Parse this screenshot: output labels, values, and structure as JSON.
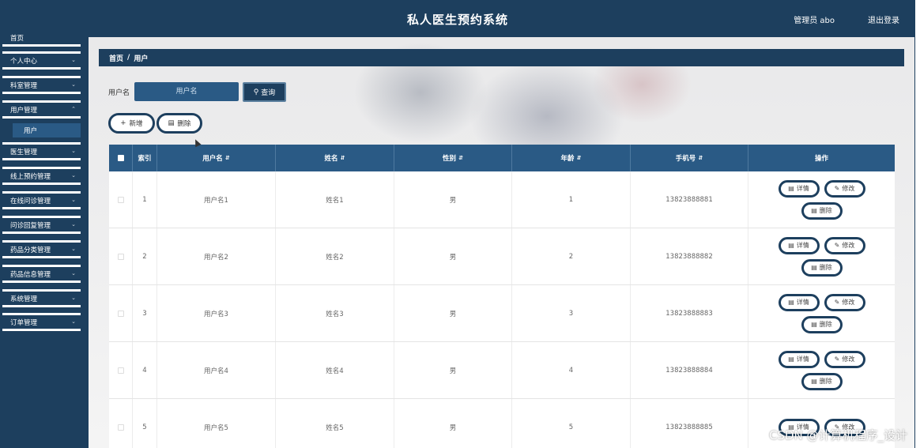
{
  "header": {
    "title": "私人医生预约系统",
    "user": "管理员 abo",
    "logout": "退出登录"
  },
  "sidebar": {
    "top_cut": "首页",
    "items": [
      {
        "label": "个人中心"
      },
      {
        "label": "科室管理"
      },
      {
        "label": "用户管理",
        "sub": "用户"
      },
      {
        "label": "医生管理"
      },
      {
        "label": "线上预约管理"
      },
      {
        "label": "在线问诊管理"
      },
      {
        "label": "问诊回复管理"
      },
      {
        "label": "药品分类管理"
      },
      {
        "label": "药品信息管理"
      },
      {
        "label": "系统管理"
      },
      {
        "label": "订单管理"
      }
    ]
  },
  "breadcrumb": {
    "home": "首页",
    "sep": "/",
    "current": "用户"
  },
  "search": {
    "label": "用户名",
    "placeholder": "用户名",
    "button": "查询"
  },
  "actions": {
    "add": "新增",
    "delete": "删除"
  },
  "table": {
    "headers": [
      "索引",
      "用户名",
      "姓名",
      "性别",
      "年龄",
      "手机号",
      "操作"
    ],
    "rows": [
      {
        "index": "1",
        "username": "用户名1",
        "name": "姓名1",
        "gender": "男",
        "age": "1",
        "phone": "13823888881"
      },
      {
        "index": "2",
        "username": "用户名2",
        "name": "姓名2",
        "gender": "男",
        "age": "2",
        "phone": "13823888882"
      },
      {
        "index": "3",
        "username": "用户名3",
        "name": "姓名3",
        "gender": "男",
        "age": "3",
        "phone": "13823888883"
      },
      {
        "index": "4",
        "username": "用户名4",
        "name": "姓名4",
        "gender": "男",
        "age": "4",
        "phone": "13823888884"
      },
      {
        "index": "5",
        "username": "用户名5",
        "name": "姓名5",
        "gender": "男",
        "age": "5",
        "phone": "13823888885"
      }
    ],
    "row_actions": {
      "detail": "详情",
      "edit": "修改",
      "delete": "删除"
    }
  },
  "watermark": "CSDN @计算机程序_设计",
  "colors": {
    "primary": "#1d3f5e",
    "header_row": "#2a5a85"
  },
  "icons": {
    "chevron": "chevron-down-icon",
    "search": "search-icon",
    "add": "plus-icon",
    "delete": "trash-icon",
    "detail": "document-icon",
    "edit": "pencil-icon"
  }
}
